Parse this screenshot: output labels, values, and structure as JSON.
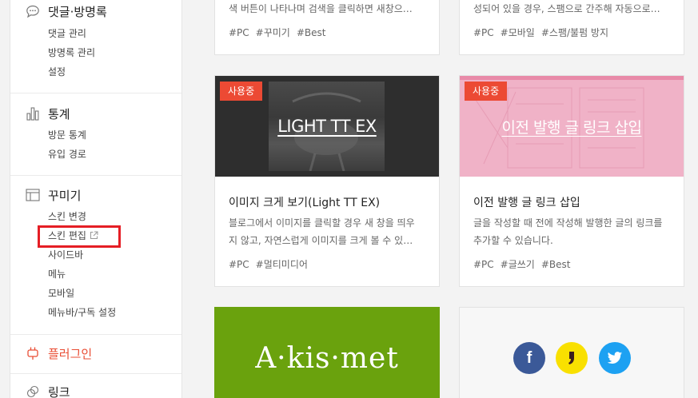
{
  "sidebar": {
    "comments": {
      "title": "댓글·방명록",
      "items": [
        "댓글 관리",
        "방명록 관리",
        "설정"
      ]
    },
    "stats": {
      "title": "통계",
      "items": [
        "방문 통계",
        "유입 경로"
      ]
    },
    "decorate": {
      "title": "꾸미기",
      "items": [
        "스킨 변경",
        "스킨 편집",
        "사이드바",
        "메뉴",
        "모바일",
        "메뉴바/구독 설정"
      ]
    },
    "plugin": {
      "title": "플러그인"
    },
    "link": {
      "title": "링크"
    }
  },
  "cards": {
    "top_left": {
      "desc": "색 버튼이 나타나며 검색을 클릭하면 새창으…",
      "tags": [
        "#PC",
        "#꾸미기",
        "#Best"
      ]
    },
    "top_right": {
      "desc": "성되어 있을 경우, 스팸으로 간주해 자동으로…",
      "tags": [
        "#PC",
        "#모바일",
        "#스팸/불펌 방지"
      ]
    },
    "light_tt": {
      "badge": "사용중",
      "thumb_text": "LIGHT TT EX",
      "title": "이미지 크게 보기(Light TT EX)",
      "desc_line1": "블로그에서 이미지를 클릭할 경우 새 창을 띄우",
      "desc_line2": "지 않고, 자연스럽게 이미지를 크게 볼 수 있…",
      "tags": [
        "#PC",
        "#멀티미디어"
      ]
    },
    "prev_link": {
      "badge": "사용중",
      "thumb_text": "이전 발행 글 링크 삽입",
      "title": "이전 발행 글 링크 삽입",
      "desc_line1": "글을 작성할 때 전에 작성해 발행한 글의 링크를",
      "desc_line2": "추가할 수 있습니다.",
      "tags": [
        "#PC",
        "#글쓰기",
        "#Best"
      ]
    },
    "akismet": {
      "logo_text": "A·kis·met",
      "bg": "#6aa20d"
    },
    "share": {
      "icons": [
        "facebook-icon",
        "kakao-icon",
        "twitter-icon"
      ],
      "colors": {
        "facebook": "#3b5998",
        "kakao": "#f9e000",
        "twitter": "#1da1f2"
      }
    }
  },
  "colors": {
    "accent": "#ec4a34",
    "highlight": "#e51e25",
    "plugin_title": "#e94e35"
  }
}
